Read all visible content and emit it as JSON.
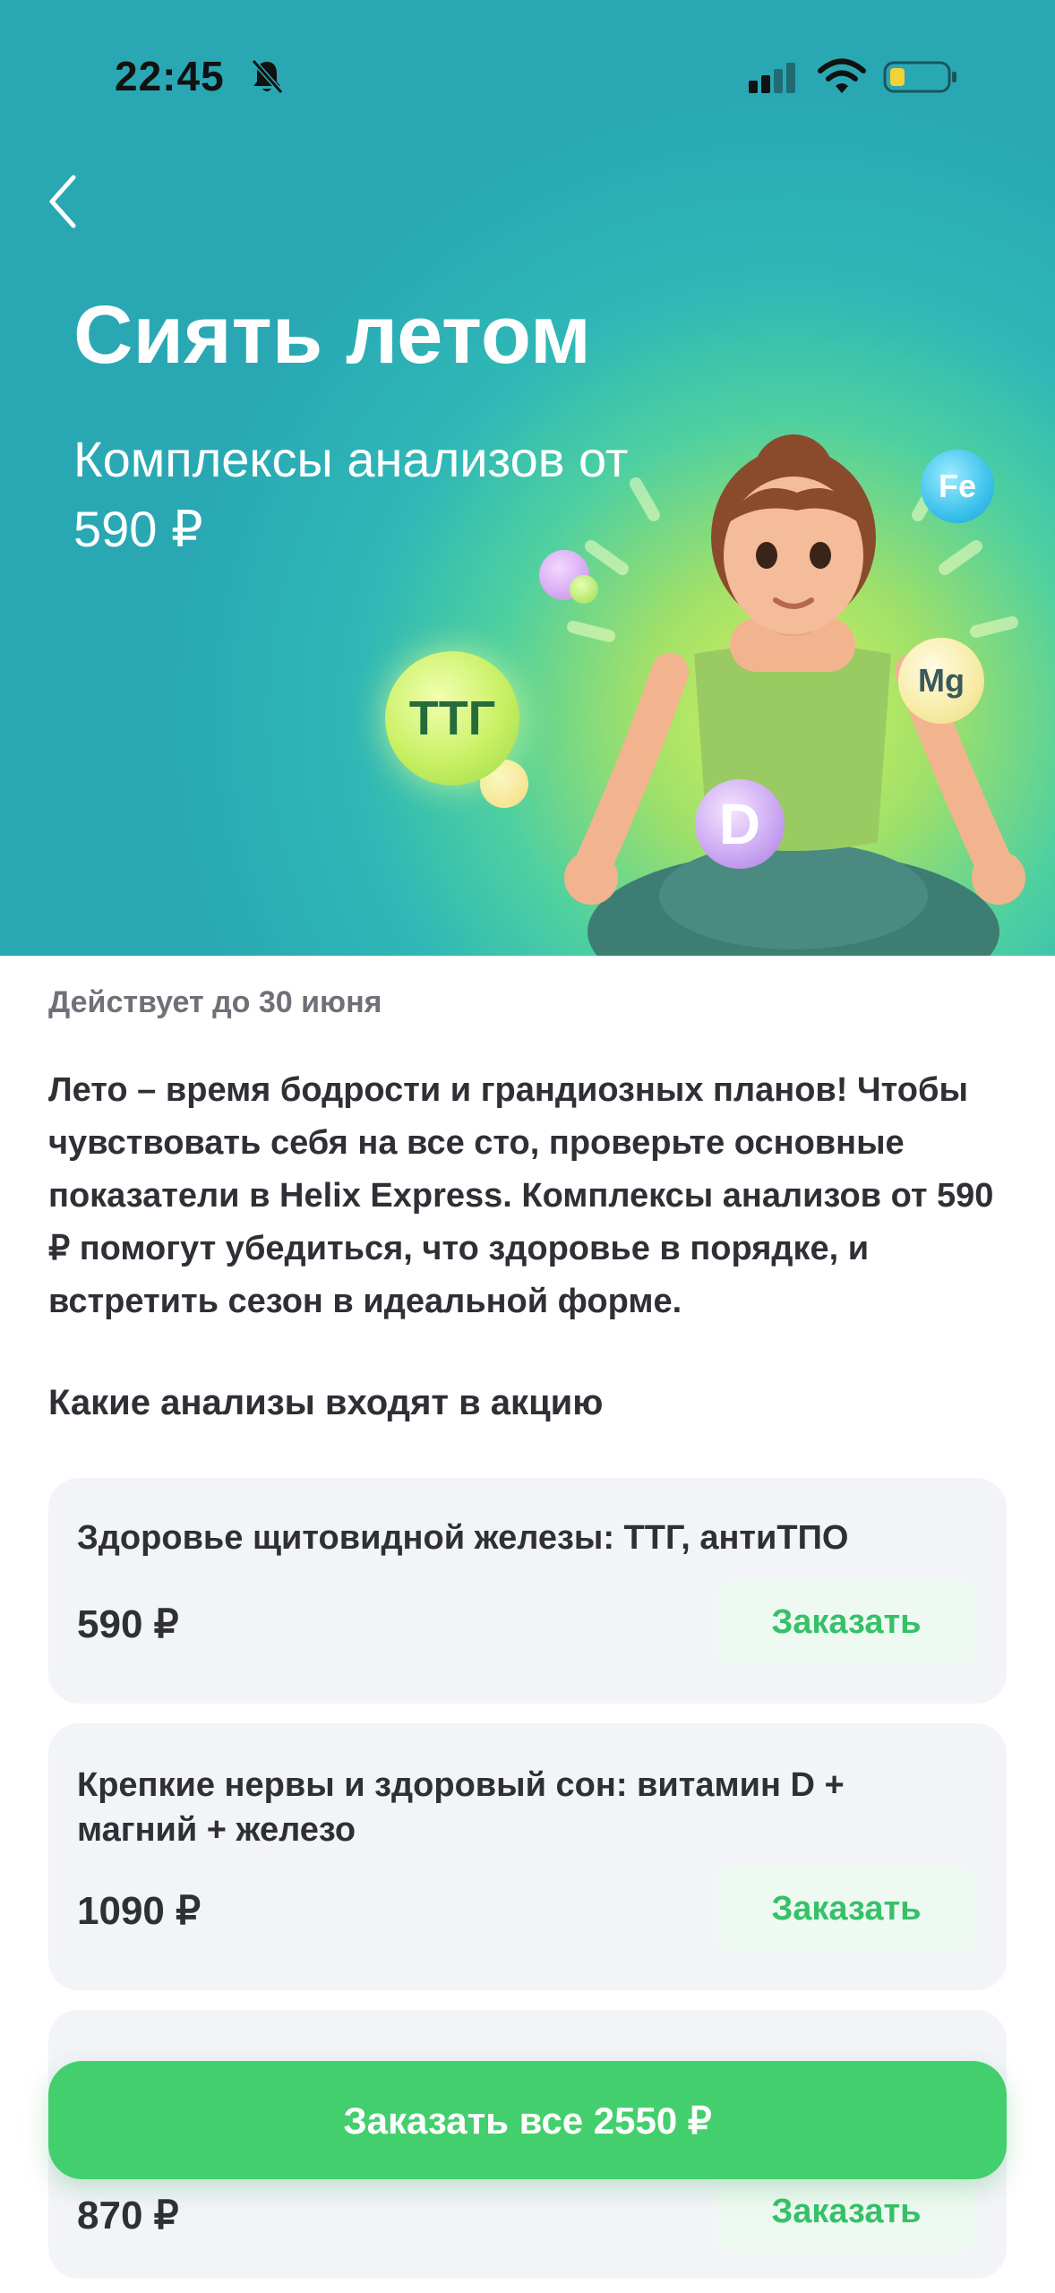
{
  "status_bar": {
    "time": "22:45"
  },
  "hero": {
    "title": "Сиять летом",
    "subtitle": "Комплексы анализов от 590 ₽",
    "bubbles": {
      "ttg": "ТТГ",
      "d": "D",
      "mg": "Mg",
      "fe": "Fe"
    }
  },
  "promo": {
    "valid_until": "Действует до 30 июня",
    "description": "Лето – время бодрости и грандиозных планов! Чтобы чувствовать себя на все сто, проверьте основные показатели в Helix Express. Комплексы анализов от 590 ₽ помогут убедиться, что здоровье в порядке, и встретить сезон в идеальной форме.",
    "section_title": "Какие анализы входят в акцию"
  },
  "items": [
    {
      "title": "Здоровье щитовидной железы: ТТГ, антиТПО",
      "price": "590 ₽",
      "button": "Заказать"
    },
    {
      "title": "Крепкие нервы и здоровый сон: витамин D + магний + железо",
      "price": "1090 ₽",
      "button": "Заказать"
    },
    {
      "title": "",
      "price": "870 ₽",
      "button": "Заказать"
    }
  ],
  "order_all_label": "Заказать все 2550 ₽",
  "colors": {
    "accent_green": "#43cf6d",
    "hero_teal": "#29a8b4",
    "card_bg": "#f3f4f8"
  }
}
